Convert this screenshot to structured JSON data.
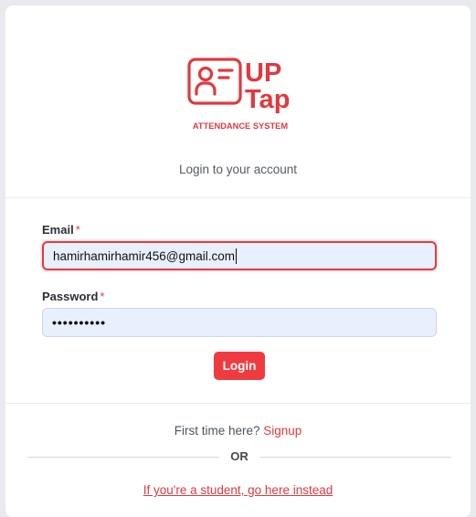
{
  "brand": {
    "logo_line1": "UP",
    "logo_line2": "Tap",
    "logo_tagline": "ATTENDANCE SYSTEM",
    "color": "#e0393e",
    "icon": "id-card-icon"
  },
  "header": {
    "subtitle": "Login to your account"
  },
  "form": {
    "email_label": "Email",
    "email_value": "hamirhamirhamir456@gmail.com",
    "password_label": "Password",
    "password_masked": "••••••••••",
    "required_marker": "*",
    "login_label": "Login"
  },
  "footer": {
    "first_time_text": "First time here?",
    "signup_label": "Signup",
    "or_text": "OR",
    "student_link": "If you're a student, go here instead"
  }
}
